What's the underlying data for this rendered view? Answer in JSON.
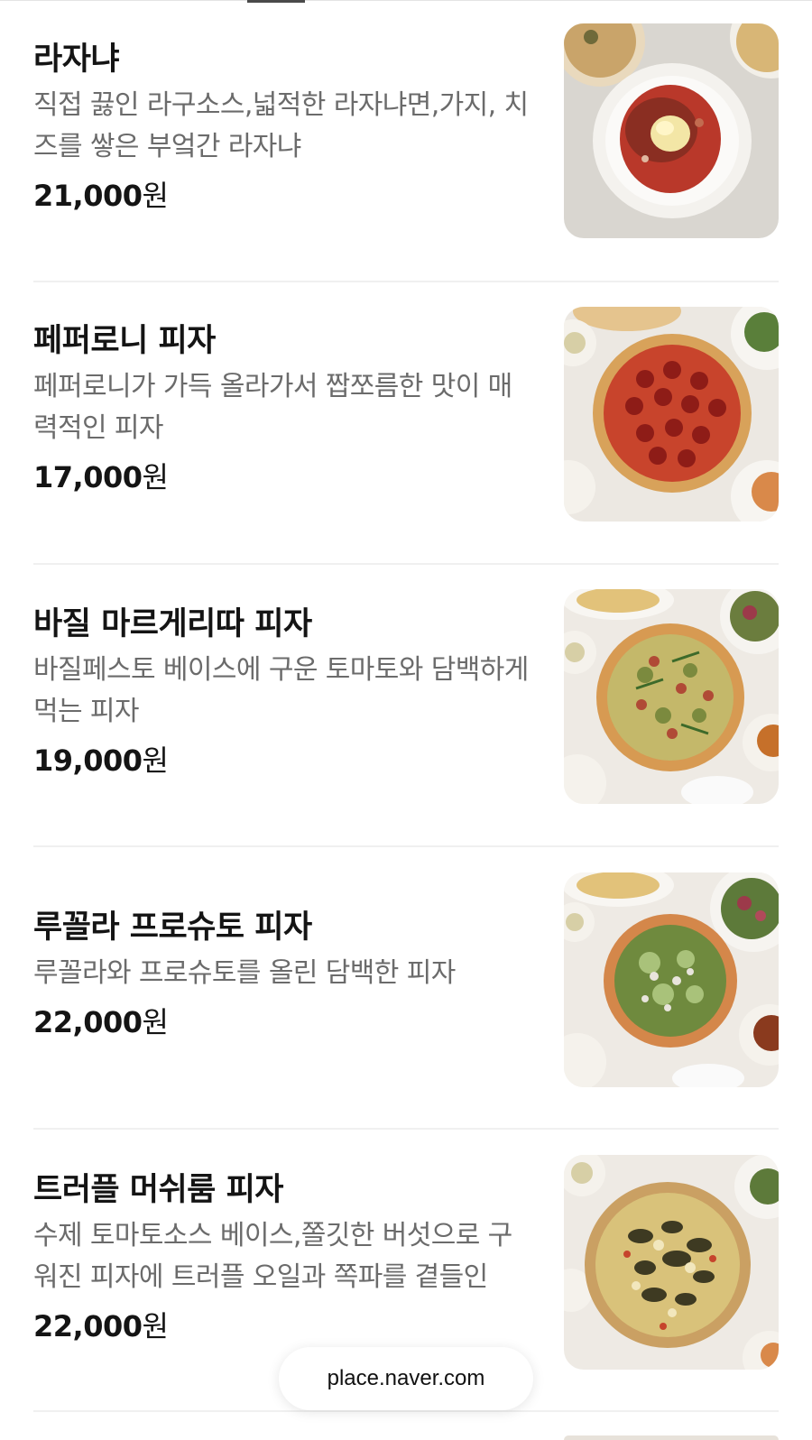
{
  "menu": {
    "items": [
      {
        "name": "라자냐",
        "description": "직접 끓인 라구소스,넓적한 라자냐면,가지, 치즈를 쌓은 부엌간 라자냐",
        "price": "21,000",
        "currency": "원",
        "image_icon": "lasagna-photo"
      },
      {
        "name": "페퍼로니 피자",
        "description": "페퍼로니가 가득 올라가서 짭쪼름한 맛이 매력적인 피자",
        "price": "17,000",
        "currency": "원",
        "image_icon": "pepperoni-pizza-photo"
      },
      {
        "name": "바질 마르게리따 피자",
        "description": "바질페스토 베이스에 구운 토마토와 담백하게 먹는 피자",
        "price": "19,000",
        "currency": "원",
        "image_icon": "basil-margherita-pizza-photo"
      },
      {
        "name": "루꼴라 프로슈토 피자",
        "description": "루꼴라와 프로슈토를 올린 담백한 피자",
        "price": "22,000",
        "currency": "원",
        "image_icon": "arugula-prosciutto-pizza-photo"
      },
      {
        "name": "트러플 머쉬룸 피자",
        "description": "수제 토마토소스 베이스,쫄깃한 버섯으로 구워진 피자에 트러플 오일과 쪽파를 곁들인",
        "price": "22,000",
        "currency": "원",
        "image_icon": "truffle-mushroom-pizza-photo"
      }
    ]
  },
  "browser": {
    "url": "place.naver.com"
  },
  "colors": {
    "text_primary": "#141414",
    "text_secondary": "#6b6b6b",
    "divider": "#f0f0f0"
  }
}
